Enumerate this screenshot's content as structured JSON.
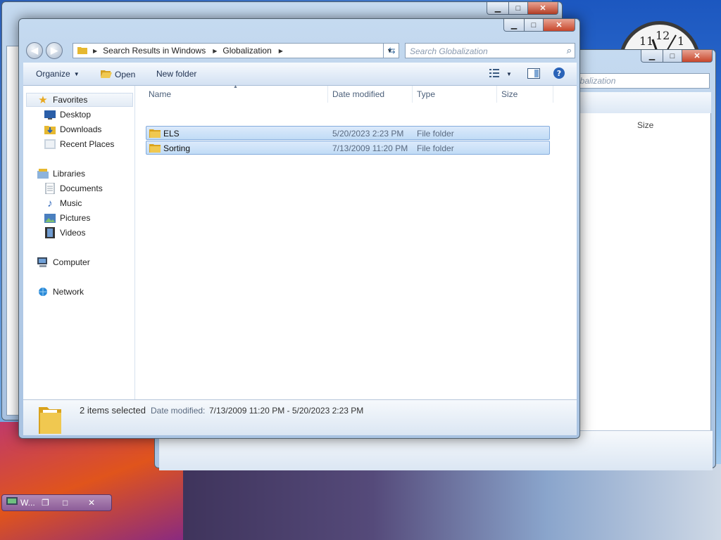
{
  "main_window": {
    "breadcrumbs": [
      "Search Results in Windows",
      "Globalization"
    ],
    "search_placeholder": "Search Globalization",
    "toolbar": {
      "organize": "Organize",
      "open": "Open",
      "new_folder": "New folder"
    },
    "nav": {
      "favorites": "Favorites",
      "favorites_items": [
        "Desktop",
        "Downloads",
        "Recent Places"
      ],
      "libraries": "Libraries",
      "libraries_items": [
        "Documents",
        "Music",
        "Pictures",
        "Videos"
      ],
      "computer": "Computer",
      "network": "Network"
    },
    "columns": [
      "Name",
      "Date modified",
      "Type",
      "Size"
    ],
    "files": [
      {
        "name": "ELS",
        "date": "5/20/2023 2:23 PM",
        "type": "File folder"
      },
      {
        "name": "Sorting",
        "date": "7/13/2009 11:20 PM",
        "type": "File folder"
      }
    ],
    "status": {
      "selection": "2 items selected",
      "date_label": "Date modified:",
      "date_value": "7/13/2009 11:20 PM - 5/20/2023 2:23 PM"
    }
  },
  "back_window": {
    "search_placeholder": "obalization",
    "size_column": "Size"
  },
  "minimized_window": {
    "title": "W..."
  },
  "clock": {
    "numbers": [
      "12",
      "1",
      "11"
    ]
  },
  "colors": {
    "selection": "#c1dcf6",
    "close_button": "#c7462b",
    "folder": "#e6b830"
  }
}
